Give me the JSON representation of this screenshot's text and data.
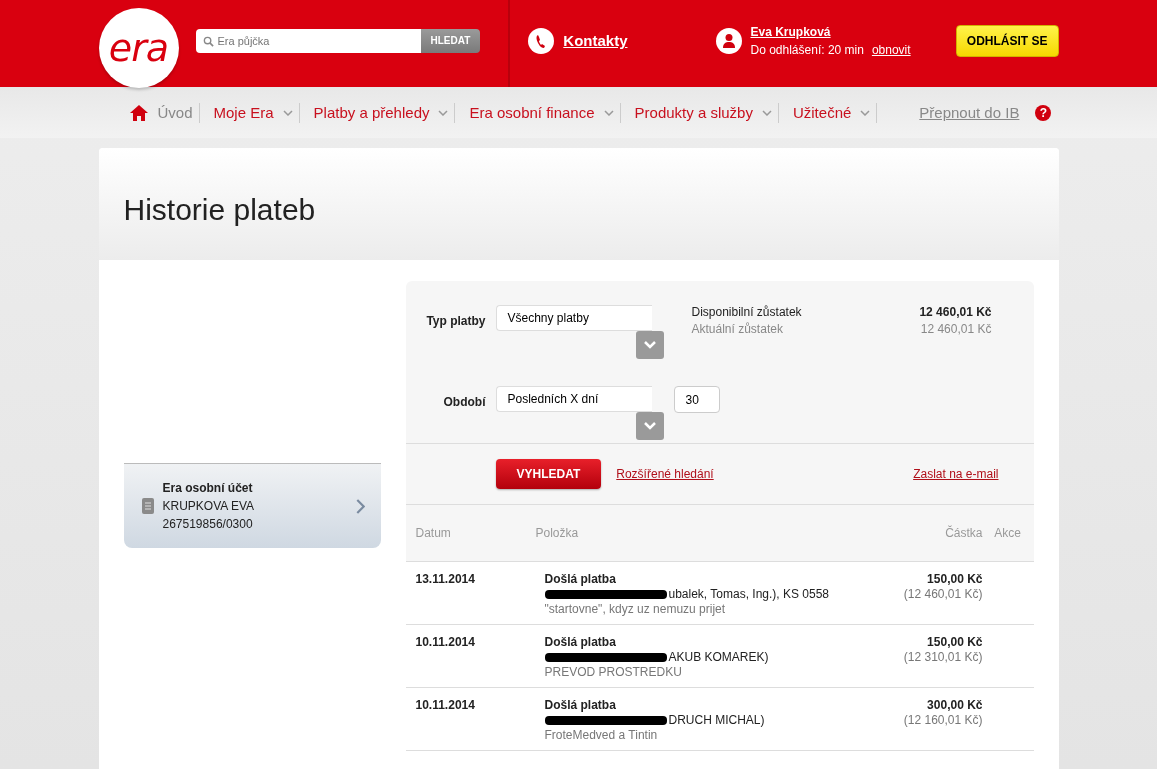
{
  "header": {
    "logo": "era",
    "search": {
      "placeholder": "Era půjčka",
      "button": "HLEDAT"
    },
    "contacts": "Kontakty",
    "user": {
      "name": "Eva Krupková",
      "logout_timer": "Do odhlášení: 20 min",
      "refresh": "obnovit"
    },
    "logout": "ODHLÁSIT SE"
  },
  "nav": {
    "items": [
      {
        "label": "Úvod",
        "kind": "home"
      },
      {
        "label": "Moje Era",
        "kind": "menu"
      },
      {
        "label": "Platby a přehledy",
        "kind": "menu"
      },
      {
        "label": "Era osobní finance",
        "kind": "menu"
      },
      {
        "label": "Produkty a služby",
        "kind": "menu"
      },
      {
        "label": "Užitečné",
        "kind": "menu"
      }
    ],
    "switch": "Přepnout do IB",
    "help": "?"
  },
  "page": {
    "title": "Historie plateb"
  },
  "account": {
    "name": "Era osobní účet",
    "owner": "KRUPKOVA EVA",
    "number": "267519856/0300"
  },
  "filters": {
    "payment_type": {
      "label": "Typ platby",
      "value": "Všechny platby"
    },
    "period": {
      "label": "Období",
      "value": "Posledních X dní",
      "days": "30"
    }
  },
  "balances": [
    {
      "label": "Disponibilní zůstatek",
      "value": "12 460,01 Kč",
      "kind": "main"
    },
    {
      "label": "Aktuální zůstatek",
      "value": "12 460,01 Kč",
      "kind": "secondary"
    }
  ],
  "actions": {
    "search": "VYHLEDAT",
    "advanced": "Rozšířené hledání",
    "email": "Zaslat na e-mail"
  },
  "table": {
    "columns": [
      "Datum",
      "Položka",
      "Částka",
      "Akce"
    ],
    "rows": [
      {
        "date": "13.11.2014",
        "title": "Došlá platba",
        "counterparty": "ubalek, Tomas, Ing.), KS 0558",
        "redacted": true,
        "note": "\"startovne\", kdyz uz nemuzu prijet",
        "amount": "150,00 Kč",
        "balance": "(12 460,01 Kč)"
      },
      {
        "date": "10.11.2014",
        "title": "Došlá platba",
        "counterparty": "AKUB KOMAREK)",
        "redacted": true,
        "note": "PREVOD PROSTREDKU",
        "amount": "150,00 Kč",
        "balance": "(12 310,01 Kč)"
      },
      {
        "date": "10.11.2014",
        "title": "Došlá platba",
        "counterparty": "DRUCH MICHAL)",
        "redacted": true,
        "note": "FroteMedved a Tintin",
        "amount": "300,00 Kč",
        "balance": "(12 160,01 Kč)"
      }
    ]
  }
}
